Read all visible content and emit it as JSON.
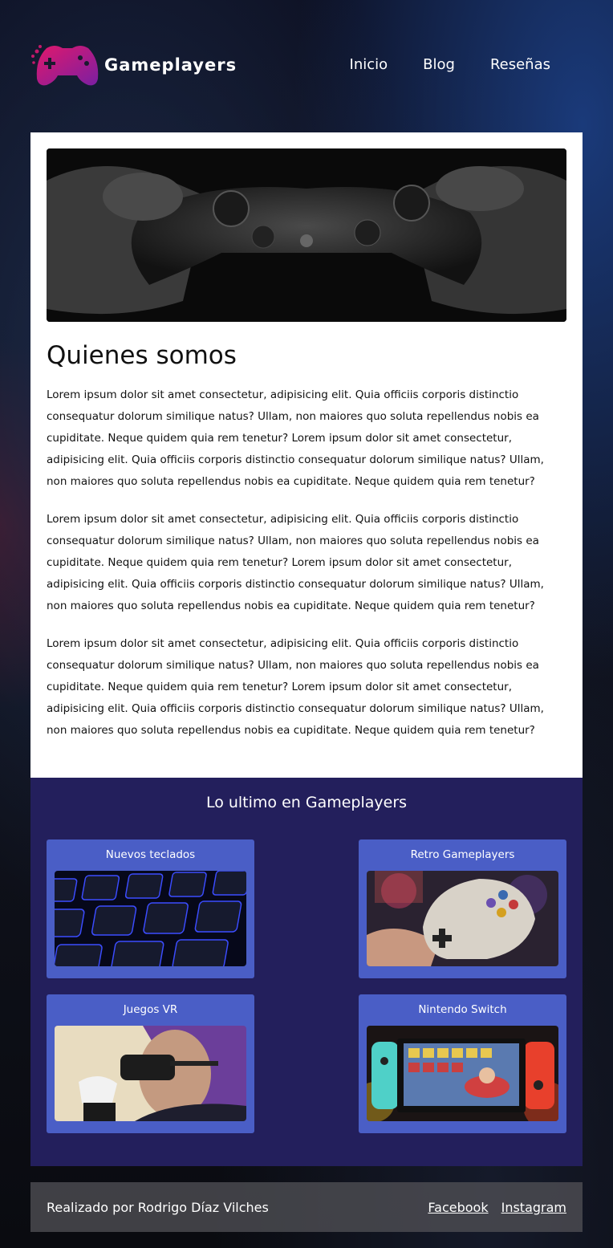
{
  "header": {
    "site_name": "Gameplayers",
    "logo_icon": "gamepad-icon",
    "nav": [
      {
        "label": "Inicio"
      },
      {
        "label": "Blog"
      },
      {
        "label": "Reseñas"
      }
    ]
  },
  "main": {
    "hero_image": "gamepad-hands-photo",
    "title": "Quienes somos",
    "paragraphs": [
      "Lorem ipsum dolor sit amet consectetur, adipisicing elit. Quia officiis corporis distinctio consequatur dolorum similique natus? Ullam, non maiores quo soluta repellendus nobis ea cupiditate. Neque quidem quia rem tenetur? Lorem ipsum dolor sit amet consectetur, adipisicing elit. Quia officiis corporis distinctio consequatur dolorum similique natus? Ullam, non maiores quo soluta repellendus nobis ea cupiditate. Neque quidem quia rem tenetur?",
      "Lorem ipsum dolor sit amet consectetur, adipisicing elit. Quia officiis corporis distinctio consequatur dolorum similique natus? Ullam, non maiores quo soluta repellendus nobis ea cupiditate. Neque quidem quia rem tenetur? Lorem ipsum dolor sit amet consectetur, adipisicing elit. Quia officiis corporis distinctio consequatur dolorum similique natus? Ullam, non maiores quo soluta repellendus nobis ea cupiditate. Neque quidem quia rem tenetur?",
      "Lorem ipsum dolor sit amet consectetur, adipisicing elit. Quia officiis corporis distinctio consequatur dolorum similique natus? Ullam, non maiores quo soluta repellendus nobis ea cupiditate. Neque quidem quia rem tenetur? Lorem ipsum dolor sit amet consectetur, adipisicing elit. Quia officiis corporis distinctio consequatur dolorum similique natus? Ullam, non maiores quo soluta repellendus nobis ea cupiditate. Neque quidem quia rem tenetur?"
    ]
  },
  "latest": {
    "title": "Lo ultimo en Gameplayers",
    "cards": [
      {
        "title": "Nuevos teclados",
        "image": "keyboard-photo"
      },
      {
        "title": "Retro Gameplayers",
        "image": "snes-controller-photo"
      },
      {
        "title": "Juegos VR",
        "image": "vr-headset-photo"
      },
      {
        "title": "Nintendo Switch",
        "image": "nintendo-switch-photo"
      }
    ]
  },
  "footer": {
    "credit": "Realizado por Rodrigo Díaz Vilches",
    "links": [
      {
        "label": "Facebook"
      },
      {
        "label": "Instagram"
      }
    ]
  },
  "colors": {
    "brand_gradient_start": "#e0186c",
    "brand_gradient_end": "#7b1fa2",
    "latest_bg": "#231f5c",
    "card_bg": "#4a5ec6"
  }
}
